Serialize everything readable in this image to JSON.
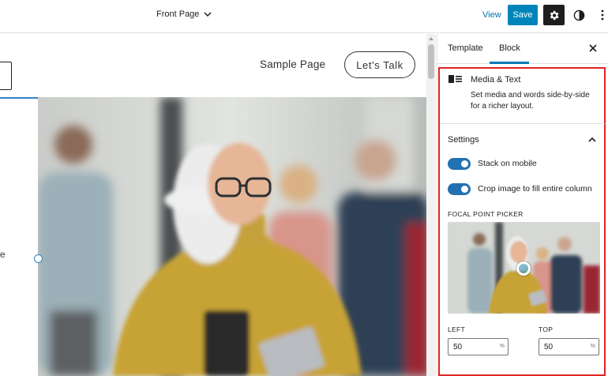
{
  "header": {
    "document_title": "Front Page",
    "view_label": "View",
    "save_label": "Save"
  },
  "canvas": {
    "nav": {
      "sample_page": "Sample Page",
      "lets_talk": "Let's  Talk"
    },
    "side_text": "e"
  },
  "sidebar": {
    "tabs": [
      {
        "label": "Template",
        "active": false
      },
      {
        "label": "Block",
        "active": true
      }
    ],
    "block": {
      "icon": "media-text-icon",
      "title": "Media & Text",
      "description": "Set media and words side-by-side for a richer layout."
    },
    "settings": {
      "title": "Settings",
      "stack_on_mobile": {
        "label": "Stack on mobile",
        "checked": true
      },
      "crop_image": {
        "label": "Crop image to fill entire column",
        "checked": true
      },
      "focal_point_label": "FOCAL POINT PICKER",
      "left_label": "LEFT",
      "top_label": "TOP",
      "left_value": "50",
      "top_value": "50",
      "unit": "%"
    }
  },
  "colors": {
    "accent": "#007cba",
    "save_button": "#0085ba",
    "toggle_on": "#2271b1",
    "highlight_frame": "#e02424"
  }
}
